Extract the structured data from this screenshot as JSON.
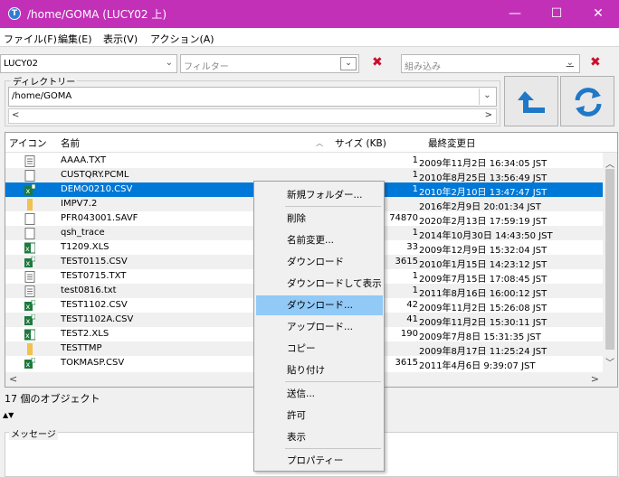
{
  "window": {
    "title": "/home/GOMA (LUCY02 上)",
    "minimize": "—",
    "maximize": "☐",
    "close": "✕"
  },
  "menu": [
    "ファイル(F)",
    "編集(E)",
    "表示(V)",
    "アクション(A)"
  ],
  "toolbar": {
    "system": "LUCY02",
    "filter_placeholder": "フィルター",
    "builtin_placeholder": "組み込み",
    "clear": "✖"
  },
  "directory": {
    "legend": "ディレクトリー",
    "path": "/home/GOMA"
  },
  "columns": {
    "icon": "アイコン",
    "name": "名前",
    "size": "サイズ (KB)",
    "modified": "最終変更日"
  },
  "files": [
    {
      "icon": "text",
      "name": "AAAA.TXT",
      "size": "1",
      "modified": "2009年11月2日 16:34:05 JST"
    },
    {
      "icon": "file",
      "name": "CUSTQRY.PCML",
      "size": "1",
      "modified": "2010年8月25日 13:56:49 JST"
    },
    {
      "icon": "excel",
      "name": "DEMO0210.CSV",
      "size": "1",
      "modified": "2010年2月10日 13:47:47 JST"
    },
    {
      "icon": "folder",
      "name": "IMPV7.2",
      "size": "",
      "modified": "2016年2月9日 20:01:34 JST"
    },
    {
      "icon": "file",
      "name": "PFR043001.SAVF",
      "size": "74870",
      "modified": "2020年2月13日 17:59:19 JST"
    },
    {
      "icon": "file",
      "name": "qsh_trace",
      "size": "1",
      "modified": "2014年10月30日 14:43:50 JST"
    },
    {
      "icon": "excel2",
      "name": "T1209.XLS",
      "size": "33",
      "modified": "2009年12月9日 15:32:04 JST"
    },
    {
      "icon": "excel",
      "name": "TEST0115.CSV",
      "size": "3615",
      "modified": "2010年1月15日 14:23:12 JST"
    },
    {
      "icon": "text",
      "name": "TEST0715.TXT",
      "size": "1",
      "modified": "2009年7月15日 17:08:45 JST"
    },
    {
      "icon": "text",
      "name": "test0816.txt",
      "size": "1",
      "modified": "2011年8月16日 16:00:12 JST"
    },
    {
      "icon": "excel",
      "name": "TEST1102.CSV",
      "size": "42",
      "modified": "2009年11月2日 15:26:08 JST"
    },
    {
      "icon": "excel",
      "name": "TEST1102A.CSV",
      "size": "41",
      "modified": "2009年11月2日 15:30:11 JST"
    },
    {
      "icon": "excel2",
      "name": "TEST2.XLS",
      "size": "190",
      "modified": "2009年7月8日 15:31:35 JST"
    },
    {
      "icon": "folder",
      "name": "TESTTMP",
      "size": "",
      "modified": "2009年8月17日 11:25:24 JST"
    },
    {
      "icon": "excel",
      "name": "TOKMASP.CSV",
      "size": "3615",
      "modified": "2011年4月6日 9:39:07 JST"
    }
  ],
  "selected_index": 2,
  "status": "17 個のオブジェクト",
  "message_legend": "メッセージ",
  "context_menu": [
    {
      "label": "新規フォルダー...",
      "sep_after": true
    },
    {
      "label": "削除"
    },
    {
      "label": "名前変更..."
    },
    {
      "label": "ダウンロード"
    },
    {
      "label": "ダウンロードして表示"
    },
    {
      "label": "ダウンロード...",
      "highlight": true
    },
    {
      "label": "アップロード..."
    },
    {
      "label": "コピー"
    },
    {
      "label": "貼り付け",
      "sep_after": true
    },
    {
      "label": "送信..."
    },
    {
      "label": "許可"
    },
    {
      "label": "表示",
      "sep_after": true
    },
    {
      "label": "プロパティー"
    }
  ],
  "colors": {
    "titlebar": "#c330b8",
    "selection": "#0078d7",
    "menu_highlight": "#91c9f7",
    "accent_blue": "#1f78c8",
    "clear_red": "#c8102e"
  }
}
